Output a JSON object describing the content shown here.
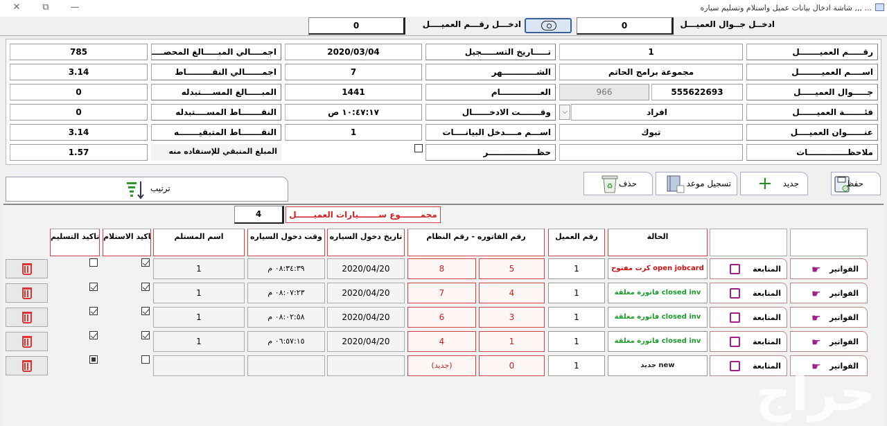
{
  "window": {
    "title": "... ,,, شاشة ادخال بيانات عميل واستلام وتسليم سياره"
  },
  "search": {
    "mobile_label": "ادخــل جــوال العميـــل",
    "mobile_value": "0",
    "number_label": "ادخـــل رقـــم العميــــل",
    "number_value": "0"
  },
  "fields": {
    "customer_no": {
      "label": "رقـــــم العميـــــــل",
      "value": "1"
    },
    "customer_name": {
      "label": "اســــم العميــــــــل",
      "value": "مجموعة برامج الحاتم"
    },
    "customer_mobile": {
      "label": "جـــــوال العميـــــل",
      "value": "555622693",
      "extra": "966"
    },
    "customer_category": {
      "label": "فئـــــــة العميــــــل",
      "value": "افراد"
    },
    "customer_address": {
      "label": "عنــــــوان العميــــل",
      "value": "تبوك"
    },
    "notes": {
      "label": "ملاحظــــــــــــــات",
      "value": ""
    },
    "reg_date": {
      "label": "تـــــاريخ التســـــجيل",
      "value": "2020/03/04"
    },
    "month": {
      "label": "الشــــــــــــهر",
      "value": "7"
    },
    "year": {
      "label": "العــــــــــــــام",
      "value": "1441"
    },
    "entry_time": {
      "label": "وقـــــــت الادخــــــال",
      "value": "١٠:٤٧:١٧ ص"
    },
    "entry_user": {
      "label": "اســـم مــــدخل البيانــــات",
      "value": "1"
    },
    "ban": {
      "label": "حظـــــــــــــــــر"
    },
    "total_collected": {
      "label": "اجمــــالي المبـــــالغ المحصــــلة",
      "value": "785"
    },
    "total_points": {
      "label": "اجمــــــالي النقـــــــــاط",
      "value": "3.14"
    },
    "amounts_redeemed": {
      "label": "المبـــــالغ المســــتبدله",
      "value": "0"
    },
    "points_redeemed": {
      "label": "النقـــــــاط المســــتبدله",
      "value": "0"
    },
    "points_remaining": {
      "label": "النقـــــــاط المتبقيـــــــه",
      "value": "3.14"
    },
    "amount_remaining": {
      "label": "المبلغ المتبقي للإستفاده منه",
      "value": "1.57"
    }
  },
  "toolbar": {
    "save": "حفظ",
    "new": "جديد",
    "appointment": "تسجيل موعد",
    "delete": "حذف",
    "sort": "ترتيب"
  },
  "cars": {
    "label": "مجمـــــــوع ســـــــيارات العميــــــل",
    "count": "4"
  },
  "table": {
    "headers": {
      "status": "الحالة",
      "customer_no": "رقم العميل",
      "invoice_system": "رقم الفاتوره - رقم النظام",
      "entry_date": "تاريخ دخول السياره",
      "entry_time": "وقت دخول السياره",
      "receiver": "اسم المستلم",
      "confirm_receive": "تاكيد الاستلام",
      "confirm_deliver": "تاكيد التسليم"
    },
    "invoices_btn": "الفواتير",
    "followup_btn": "المتابعة",
    "rows": [
      {
        "status_ar": "كرت مفتوح",
        "status_en": "open jobcard",
        "customer_no": "1",
        "invoice": "5",
        "system": "8",
        "entry_date": "2020/04/20",
        "entry_time": "٠٨:٣٤:٣٩ م",
        "receiver": "1"
      },
      {
        "status_ar": "فاتورة مغلقة",
        "status_en": "closed inv",
        "customer_no": "1",
        "invoice": "4",
        "system": "7",
        "entry_date": "2020/04/20",
        "entry_time": "٠٨:٠٧:٢٣ م",
        "receiver": "1"
      },
      {
        "status_ar": "فاتورة مغلقة",
        "status_en": "closed inv",
        "customer_no": "1",
        "invoice": "3",
        "system": "6",
        "entry_date": "2020/04/20",
        "entry_time": "٠٨:٠٢:٥٨ م",
        "receiver": "1"
      },
      {
        "status_ar": "فاتورة مغلقة",
        "status_en": "closed inv",
        "customer_no": "1",
        "invoice": "1",
        "system": "4",
        "entry_date": "2020/04/20",
        "entry_time": "٠٦:٥٧:١٥ م",
        "receiver": "1"
      },
      {
        "status_ar": "جديد",
        "status_en": "new",
        "customer_no": "1",
        "invoice": "0",
        "system": "(جديد)",
        "entry_date": "",
        "entry_time": "",
        "receiver": ""
      }
    ]
  },
  "colors": {
    "open": "#d01010",
    "closed": "#1a9a2a",
    "accent_red": "#c44444"
  },
  "watermark": "حراج"
}
